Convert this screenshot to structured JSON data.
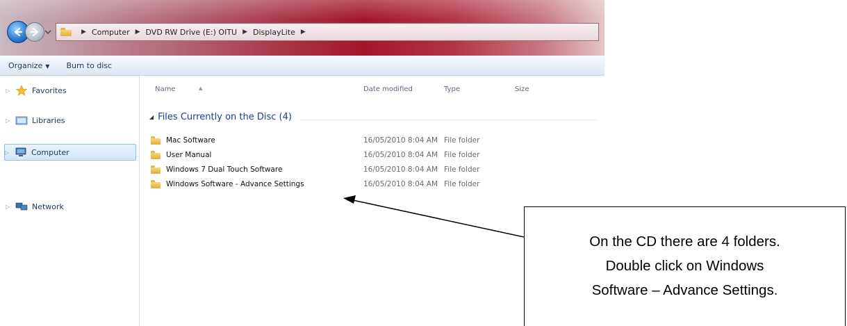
{
  "address": {
    "crumbs": [
      "Computer",
      "DVD RW Drive (E:) OITU",
      "DisplayLite"
    ]
  },
  "toolbar": {
    "organize_label": "Organize",
    "burn_label": "Burn to disc"
  },
  "nav": {
    "items": [
      {
        "label": "Favorites",
        "icon": "star-icon"
      },
      {
        "label": "Libraries",
        "icon": "libraries-icon"
      },
      {
        "label": "Computer",
        "icon": "computer-icon"
      },
      {
        "label": "Network",
        "icon": "network-icon"
      }
    ],
    "selected": "Computer"
  },
  "columns": {
    "name": "Name",
    "date": "Date modified",
    "type": "Type",
    "size": "Size"
  },
  "group": {
    "label": "Files Currently on the Disc (4)"
  },
  "files": [
    {
      "name": "Mac Software",
      "date": "16/05/2010 8:04 AM",
      "type": "File folder"
    },
    {
      "name": "User Manual",
      "date": "16/05/2010 8:04 AM",
      "type": "File folder"
    },
    {
      "name": "Windows 7 Dual Touch Software",
      "date": "16/05/2010 8:04 AM",
      "type": "File folder"
    },
    {
      "name": "Windows Software - Advance Settings",
      "date": "16/05/2010 8:04 AM",
      "type": "File folder"
    }
  ],
  "callout": {
    "line1": "On the CD there are 4 folders.",
    "line2": "Double click on Windows",
    "line3": "Software – Advance Settings."
  },
  "colors": {
    "titlebar_accent": "#a3162a",
    "link_blue": "#1e3c8a",
    "toolbar_bg": "#e9f0f8"
  }
}
